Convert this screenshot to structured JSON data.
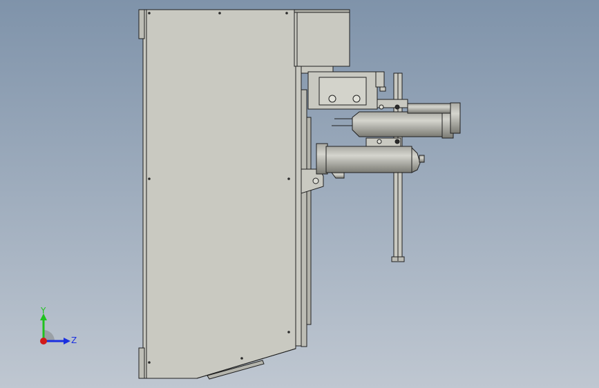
{
  "viewport": {
    "title": "",
    "background_top": "#7f93aa",
    "background_bottom": "#bfc7d1"
  },
  "model": {
    "icon": "side-view-cabinet-assembly",
    "face_color": "#c9c9c1",
    "edge_color": "#1f1f1f",
    "cylinder_color": "#8d8d86"
  },
  "triad": {
    "y_label": "Y",
    "z_label": "Z",
    "y_color": "#1fc21f",
    "z_color": "#1a2fe0",
    "x_color": "#d11a1a"
  }
}
